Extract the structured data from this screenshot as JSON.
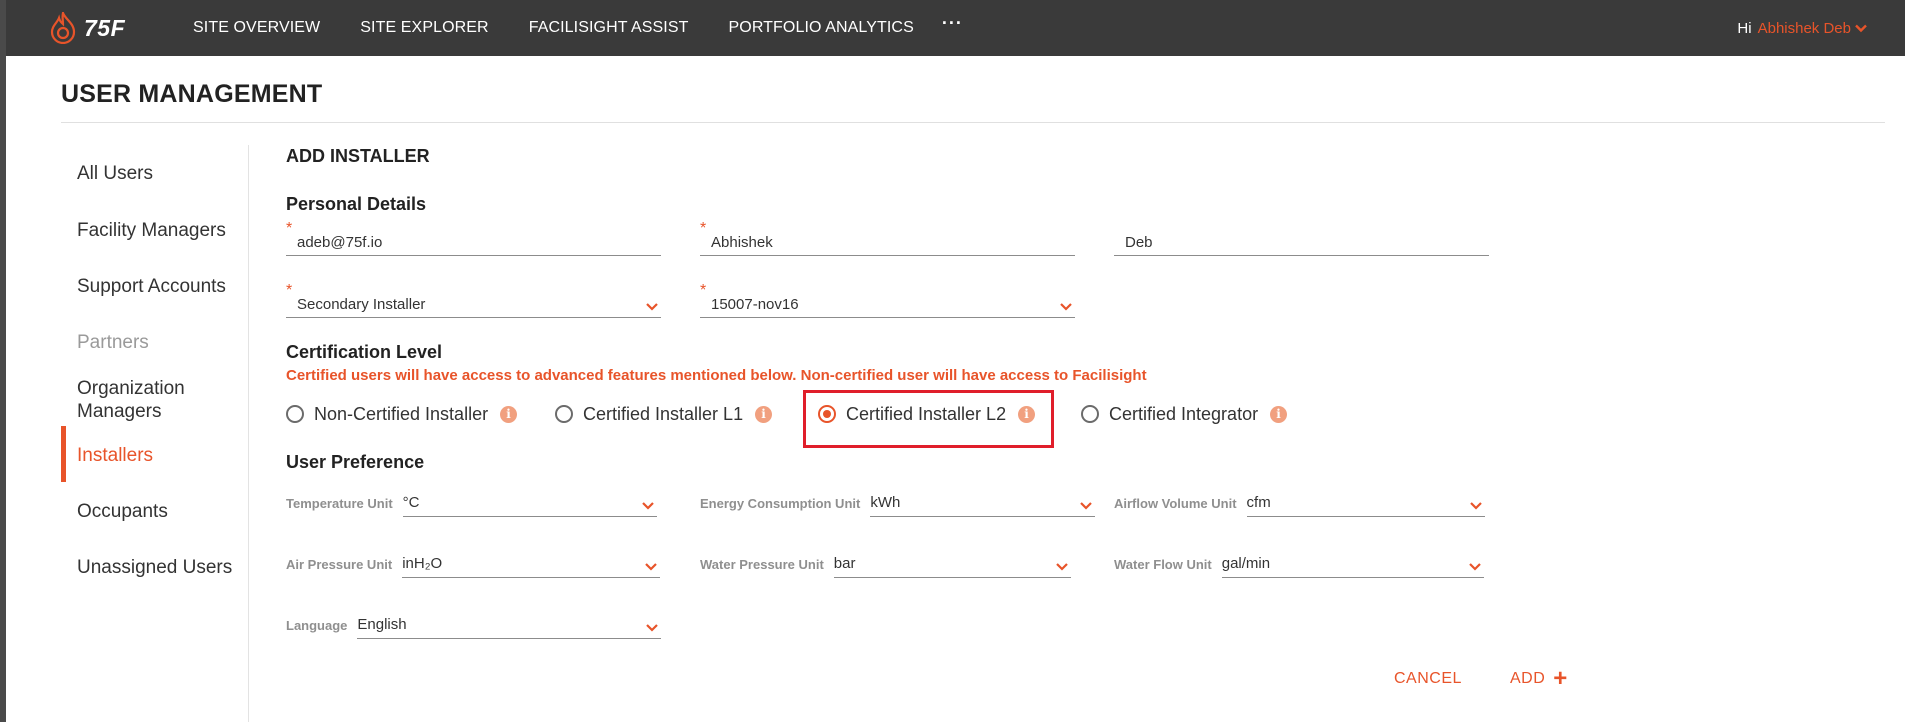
{
  "brand": {
    "logo_text": "75F",
    "accent": "#e8542a"
  },
  "nav": {
    "items": [
      "SITE OVERVIEW",
      "SITE EXPLORER",
      "FACILISIGHT ASSIST",
      "PORTFOLIO ANALYTICS"
    ],
    "more": "···",
    "greeting": "Hi",
    "user_name": "Abhishek Deb"
  },
  "page": {
    "title": "USER MANAGEMENT"
  },
  "sidebar": {
    "items": [
      {
        "label": "All Users"
      },
      {
        "label": "Facility Managers"
      },
      {
        "label": "Support Accounts"
      },
      {
        "label": "Partners"
      },
      {
        "label": "Organization Managers"
      },
      {
        "label": "Installers"
      },
      {
        "label": "Occupants"
      },
      {
        "label": "Unassigned Users"
      }
    ],
    "active": "Installers"
  },
  "form": {
    "heading": "ADD INSTALLER",
    "personal": {
      "heading": "Personal Details",
      "email": "adeb@75f.io",
      "first_name": "Abhishek",
      "last_name": "Deb",
      "role": "Secondary Installer",
      "site": "15007-nov16"
    },
    "certification": {
      "heading": "Certification Level",
      "note": "Certified users will have access to advanced features mentioned below. Non-certified user will have access to Facilisight",
      "options": [
        "Non-Certified Installer",
        "Certified Installer L1",
        "Certified Installer L2",
        "Certified Integrator"
      ],
      "selected": "Certified Installer L2"
    },
    "preferences": {
      "heading": "User Preference",
      "temperature_label": "Temperature Unit",
      "temperature_value": "°C",
      "energy_label": "Energy Consumption Unit",
      "energy_value": "kWh",
      "airflow_label": "Airflow Volume Unit",
      "airflow_value": "cfm",
      "air_pressure_label": "Air Pressure Unit",
      "air_pressure_value": "inH₂O",
      "water_pressure_label": "Water Pressure Unit",
      "water_pressure_value": "bar",
      "water_flow_label": "Water Flow Unit",
      "water_flow_value": "gal/min",
      "language_label": "Language",
      "language_value": "English"
    },
    "actions": {
      "cancel": "CANCEL",
      "add": "ADD",
      "add_icon": "+"
    }
  }
}
